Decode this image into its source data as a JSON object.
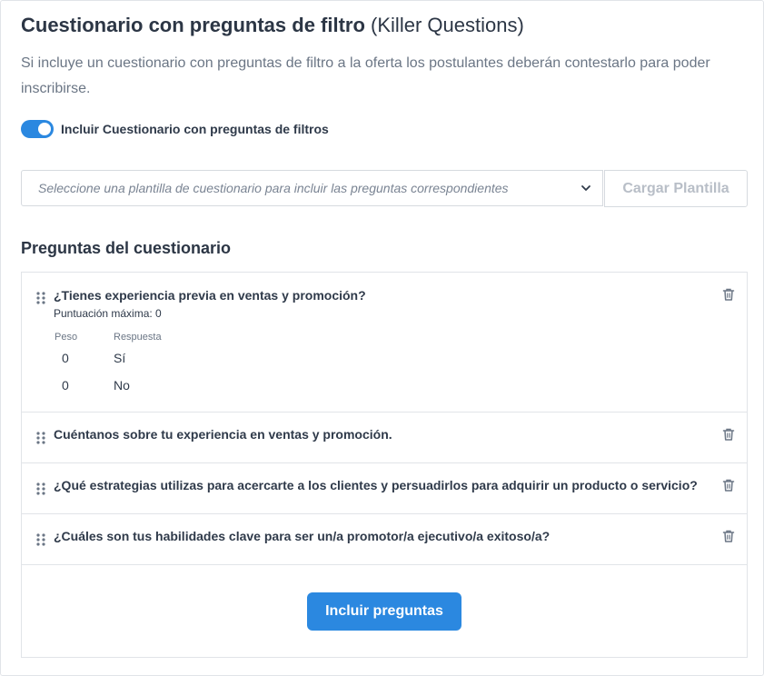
{
  "header": {
    "title_bold": "Cuestionario con preguntas de filtro",
    "title_light": "(Killer Questions)",
    "description": "Si incluye un cuestionario con preguntas de filtro a la oferta los postulantes deberán contestarlo para poder inscribirse."
  },
  "toggle": {
    "label": "Incluir Cuestionario con preguntas de filtros",
    "checked": true
  },
  "template": {
    "placeholder": "Seleccione una plantilla de cuestionario para incluir las preguntas correspondientes",
    "load_label": "Cargar Plantilla"
  },
  "questions_section": {
    "title": "Preguntas del cuestionario",
    "questions": [
      {
        "text": "¿Tienes experiencia previa en ventas y promoción?",
        "score_label": "Puntuación máxima: 0",
        "weight_header": "Peso",
        "answer_header": "Respuesta",
        "answers": [
          {
            "weight": "0",
            "answer": "Sí"
          },
          {
            "weight": "0",
            "answer": "No"
          }
        ]
      },
      {
        "text": "Cuéntanos sobre tu experiencia en ventas y promoción."
      },
      {
        "text": "¿Qué estrategias utilizas para acercarte a los clientes y persuadirlos para adquirir un producto o servicio?"
      },
      {
        "text": "¿Cuáles son tus habilidades clave para ser un/a promotor/a ejecutivo/a exitoso/a?"
      }
    ],
    "include_label": "Incluir preguntas"
  },
  "colors": {
    "accent": "#2b88e0",
    "text": "#2f3a4a",
    "muted": "#6b7685",
    "border": "#e1e4e8"
  },
  "icons": {
    "drag": "drag-handle-icon",
    "delete": "trash-icon",
    "dropdown": "chevron-down-icon"
  }
}
